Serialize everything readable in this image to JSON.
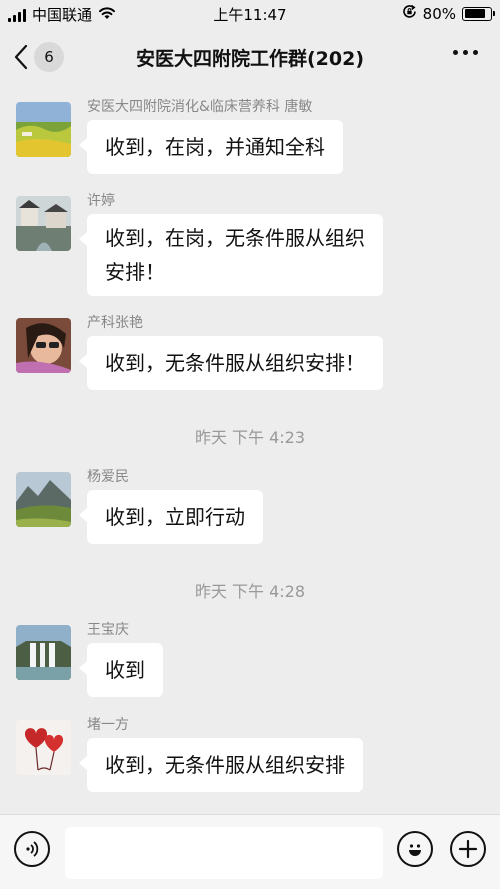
{
  "status_bar": {
    "carrier": "中国联通",
    "time": "上午11:47",
    "battery_percent": "80%",
    "battery_level": 0.8,
    "icons": [
      "signal-icon",
      "wifi-icon",
      "orientation-lock-icon",
      "battery-icon"
    ]
  },
  "nav": {
    "back_icon": "chevron-left-icon",
    "unread_count": "6",
    "title": "安医大四附院工作群(202)",
    "more_icon": "more-dots-icon"
  },
  "messages": [
    {
      "sender": "安医大四附院消化&临床营养科 唐敏",
      "lines": [
        "收到，在岗，并通知全科"
      ]
    },
    {
      "sender": "许婷",
      "lines": [
        "收到，在岗，无条件服从组织",
        "安排！"
      ]
    },
    {
      "sender": "产科张艳",
      "lines": [
        "收到，无条件服从组织安排！"
      ]
    },
    {
      "timestamp": "昨天 下午 4:23"
    },
    {
      "sender": "杨爱民",
      "lines": [
        "收到，立即行动"
      ]
    },
    {
      "timestamp": "昨天 下午 4:28"
    },
    {
      "sender": "王宝庆",
      "lines": [
        "收到"
      ]
    },
    {
      "sender": "堵一方",
      "lines": [
        "收到，无条件服从组织安排"
      ]
    }
  ],
  "input_bar": {
    "voice_icon": "voice-icon",
    "text_value": "",
    "emoji_icon": "emoji-icon",
    "add_icon": "plus-icon"
  },
  "colors": {
    "background": "#ededed",
    "bubble": "#ffffff",
    "sender_text": "#888888",
    "timestamp_text": "#999999"
  }
}
